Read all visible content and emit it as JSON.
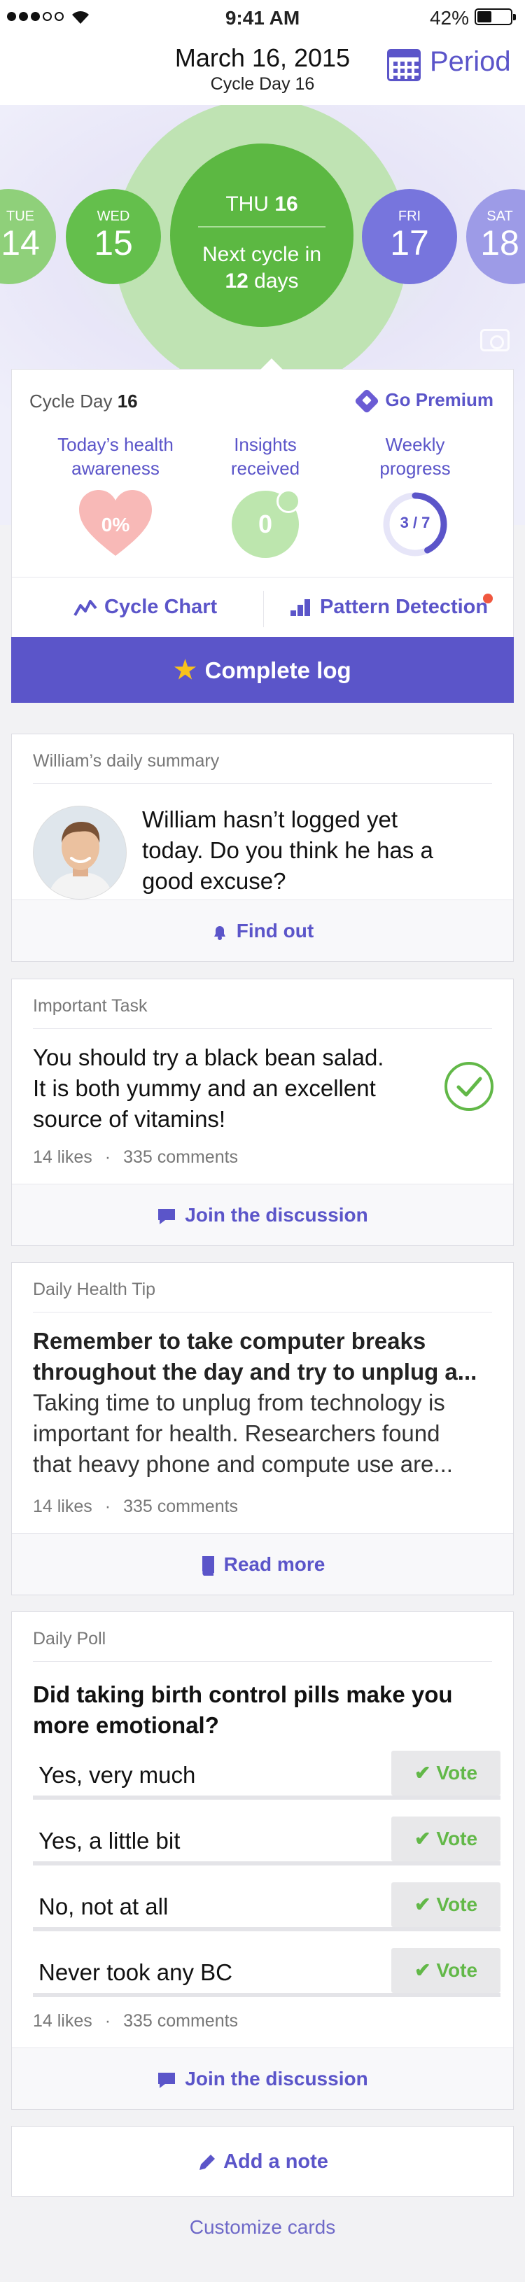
{
  "status_bar": {
    "time": "9:41 AM",
    "battery_percent": "42%",
    "battery_level": 0.42
  },
  "header": {
    "date": "March 16, 2015",
    "cycle_day": "Cycle Day 16",
    "period_label": "Period"
  },
  "calendar_strip": {
    "days": [
      {
        "name": "TUE",
        "num": "14"
      },
      {
        "name": "WED",
        "num": "15"
      },
      {
        "name": "FRI",
        "num": "17"
      },
      {
        "name": "SAT",
        "num": "18"
      }
    ],
    "today": {
      "dow": "THU",
      "num": "16",
      "next_prefix": "Next cycle in",
      "next_count": "12",
      "next_unit": "days"
    }
  },
  "main_card": {
    "cycle_label": "Cycle Day",
    "cycle_num": "16",
    "premium": "Go Premium",
    "metrics": [
      {
        "line1": "Today’s health",
        "line2": "awareness",
        "value": "0%"
      },
      {
        "line1": "Insights",
        "line2": "received",
        "value": "0"
      },
      {
        "line1": "Weekly",
        "line2": "progress",
        "value": "3 / 7",
        "fraction": 0.4286
      }
    ],
    "tools": {
      "chart": "Cycle Chart",
      "pattern": "Pattern Detection"
    },
    "complete_log": "Complete log"
  },
  "summary_card": {
    "title": "William’s daily summary",
    "lines": [
      "William hasn’t logged yet",
      "today. Do you think he has a",
      "good excuse?"
    ],
    "footer": "Find out"
  },
  "task_card": {
    "title": "Important Task",
    "lines": [
      "You should try a black bean salad.",
      "It is both yummy and an excellent",
      "source of vitamins!"
    ],
    "likes": "14 likes",
    "sep": "·",
    "comments": "335 comments",
    "footer": "Join the discussion"
  },
  "tip_card": {
    "title": "Daily Health Tip",
    "heading": [
      "Remember to take computer breaks",
      "throughout the day and try to unplug a..."
    ],
    "body": [
      "Taking time to unplug from technology is",
      "important for health. Researchers found",
      "that heavy phone and compute use are..."
    ],
    "likes": "14 likes",
    "sep": "·",
    "comments": "335 comments",
    "footer": "Read more"
  },
  "poll_card": {
    "title": "Daily Poll",
    "question": [
      "Did taking birth control pills make you",
      "more emotional?"
    ],
    "options": [
      "Yes, very much",
      "Yes, a little bit",
      "No, not at all",
      "Never took any BC"
    ],
    "vote_label": "Vote",
    "likes": "14 likes",
    "sep": "·",
    "comments": "335 comments",
    "footer": "Join the discussion"
  },
  "add_note": "Add a note",
  "customize": "Customize cards",
  "colors": {
    "accent": "#5b55c9",
    "green": "#5cb842",
    "star": "#f7c21b",
    "badge": "#f0573f",
    "heart": "#f8b9b7"
  }
}
